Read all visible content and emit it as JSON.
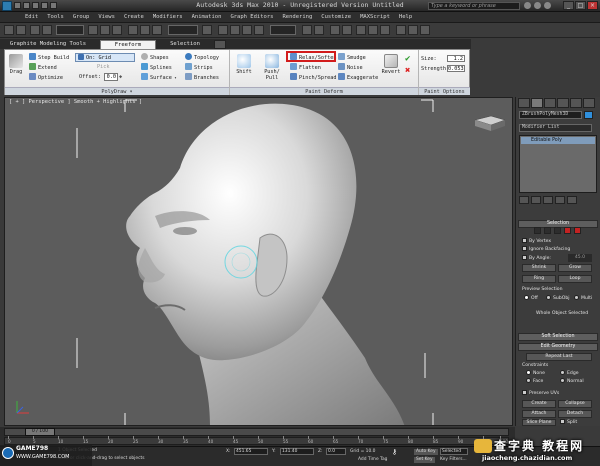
{
  "app": {
    "title": "Autodesk 3ds Max  2010  - Unregistered Version  Untitled",
    "search_placeholder": "Type a keyword or phrase"
  },
  "menu": [
    "Edit",
    "Tools",
    "Group",
    "Views",
    "Create",
    "Modifiers",
    "Animation",
    "Graph Editors",
    "Rendering",
    "Customize",
    "MAXScript",
    "Help"
  ],
  "ribbon": {
    "tabs": [
      "Graphite Modeling Tools",
      "Freeform",
      "Selection"
    ],
    "active_tab": "Freeform",
    "polydraw": {
      "caption": "PolyDraw",
      "drag": "Drag",
      "step_build": "Step Build",
      "extend": "Extend",
      "optimize": "Optimize",
      "on_grid": "On: Grid",
      "pick": "Pick",
      "offset_label": "Offset:",
      "offset_value": "0.0",
      "shapes": "Shapes",
      "splines": "Splines",
      "surface": "Surface",
      "topology": "Topology",
      "strips": "Strips",
      "branches": "Branches"
    },
    "paint_deform": {
      "caption": "Paint Deform",
      "shift": "Shift",
      "push_pull_1": "Push/",
      "push_pull_2": "Pull",
      "relax_soften": "Relax/Soften",
      "flatten": "Flatten",
      "pinch_spread": "Pinch/Spread",
      "smudge": "Smudge",
      "noise": "Noise",
      "exaggerate": "Exaggerate",
      "revert": "Revert"
    },
    "paint_options": {
      "caption": "Paint Options",
      "size_label": "Size:",
      "size_value": "1.2",
      "strength_label": "Strength:",
      "strength_value": "0.053"
    }
  },
  "viewport": {
    "label": "[ + ] Perspective ] Smooth + Highlights ]"
  },
  "command_panel": {
    "object_name": "ZBrushPolyMesh3D",
    "modifier_list": "Modifier List",
    "stack_item": "Editable Poly",
    "selection": {
      "title": "Selection",
      "by_vertex": "By Vertex",
      "ignore_backfacing": "Ignore Backfacing",
      "by_angle": "By Angle:",
      "by_angle_value": "45.0",
      "shrink": "Shrink",
      "grow": "Grow",
      "ring": "Ring",
      "loop": "Loop",
      "preview_selection": "Preview Selection",
      "preview_off": "Off",
      "preview_subobj": "SubObj",
      "preview_multi": "Multi",
      "status": "Whole Object Selected"
    },
    "soft_selection": {
      "title": "Soft Selection"
    },
    "edit_geometry": {
      "title": "Edit Geometry",
      "repeat_last": "Repeat Last",
      "constraints": "Constraints",
      "none": "None",
      "edge": "Edge",
      "face": "Face",
      "normal": "Normal",
      "preserve_uvs": "Preserve UVs",
      "create": "Create",
      "collapse": "Collapse",
      "attach": "Attach",
      "detach": "Detach",
      "slice_plane": "Slice Plane",
      "split": "Split"
    }
  },
  "timeline": {
    "frame": "0 / 100",
    "ticks": [
      "0",
      "5",
      "10",
      "15",
      "20",
      "25",
      "30",
      "35",
      "40",
      "45",
      "50",
      "55",
      "60",
      "65",
      "70",
      "75",
      "80",
      "85",
      "90",
      "95",
      "100"
    ]
  },
  "status": {
    "object_selected": "1 Object Selected",
    "hint": "Click or click-and-drag to select objects",
    "x_label": "X:",
    "x_value": "451.65",
    "y_label": "Y:",
    "y_value": "131.40",
    "z_label": "Z:",
    "z_value": "0.0",
    "grid": "Grid = 10.0",
    "auto_key": "Auto Key",
    "selected": "Selected",
    "set_key": "Set Key",
    "key_filters": "Key Filters...",
    "add_time_tag": "Add Time Tag"
  },
  "logos": {
    "left_1": "GAME798",
    "left_2": "WWW.GAME798.COM",
    "right_cn": "查字典 教程网",
    "right_url": "jiaocheng.chazidian.com"
  },
  "colors": {
    "highlight_box": "#d21c1c",
    "object_color": "#2f8fdc",
    "viewport_bg": "#5c5c5c",
    "stack_item": "#7f9cbb"
  }
}
